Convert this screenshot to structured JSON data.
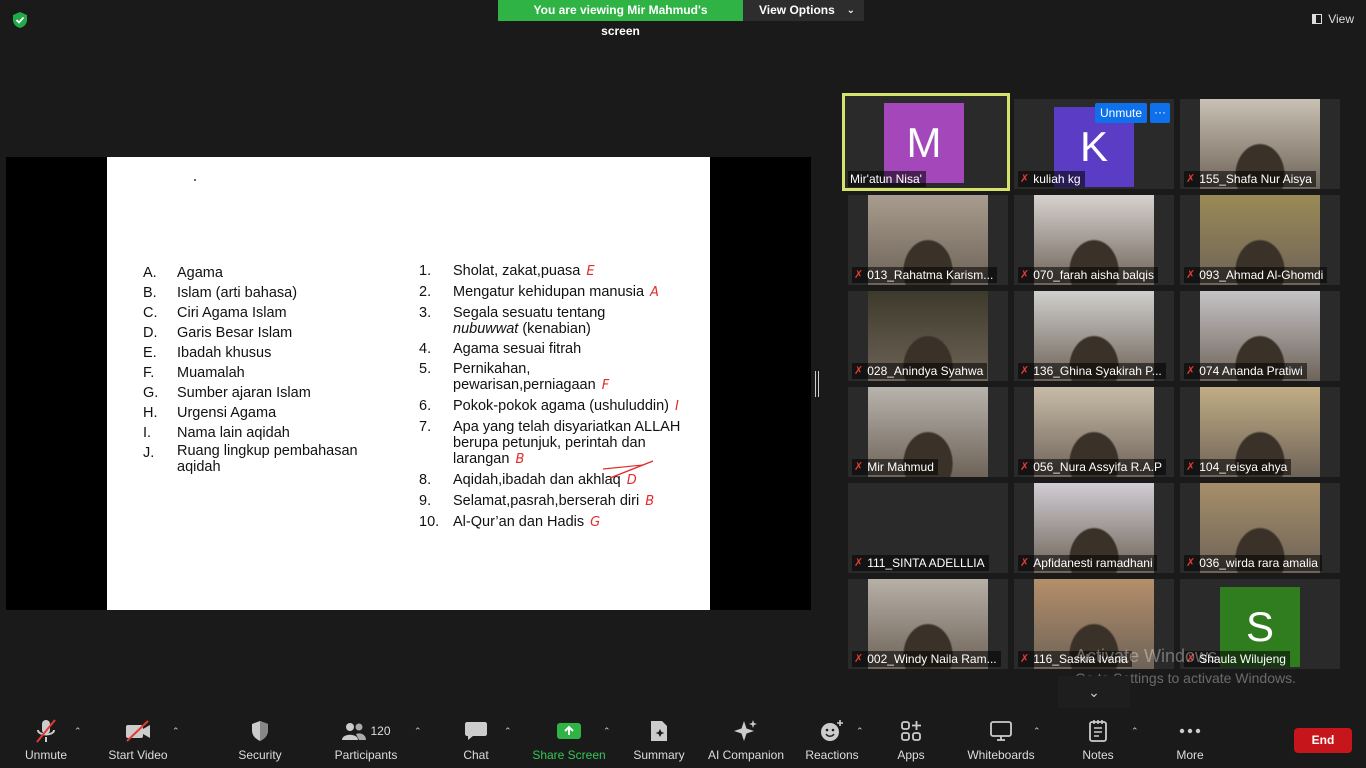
{
  "banner": {
    "viewing": "You are viewing Mir Mahmud's screen",
    "view_options": "View Options"
  },
  "top_right": {
    "view_label": "View"
  },
  "slide": {
    "left_items": [
      {
        "key": "A.",
        "text": "Agama"
      },
      {
        "key": "B.",
        "text": "Islam (arti bahasa)"
      },
      {
        "key": "C.",
        "text": "Ciri Agama Islam"
      },
      {
        "key": "D.",
        "text": "Garis Besar Islam"
      },
      {
        "key": "E.",
        "text": "Ibadah khusus"
      },
      {
        "key": "F.",
        "text": "Muamalah"
      },
      {
        "key": "G.",
        "text": "Sumber ajaran Islam"
      },
      {
        "key": "H.",
        "text": "Urgensi Agama"
      },
      {
        "key": "I.",
        "text": "Nama lain aqidah"
      },
      {
        "key": "J.",
        "text": "Ruang lingkup pembahasan aqidah"
      }
    ],
    "right_items": [
      {
        "key": "1.",
        "text": "Sholat, zakat,puasa",
        "mark": "E"
      },
      {
        "key": "2.",
        "text": "Mengatur kehidupan manusia",
        "mark": "A"
      },
      {
        "key": "3.",
        "text_a": "Segala sesuatu tentang",
        "text_italic": "nubuwwat",
        "text_b": "(kenabian)"
      },
      {
        "key": "4.",
        "text": "Agama sesuai fitrah"
      },
      {
        "key": "5.",
        "text": "Pernikahan, pewarisan,perniagaan",
        "mark": "F"
      },
      {
        "key": "6.",
        "text": "Pokok-pokok agama (ushuluddin)",
        "mark": "I"
      },
      {
        "key": "7.",
        "text": "Apa yang telah disyariatkan ALLAH berupa petunjuk, perintah dan larangan",
        "mark": "B"
      },
      {
        "key": "8.",
        "text": "Aqidah,ibadah dan akhlaq",
        "mark": "D"
      },
      {
        "key": "9.",
        "text": "Selamat,pasrah,berserah diri",
        "mark": "B"
      },
      {
        "key": "10.",
        "text": "Al-Qur’an dan Hadis",
        "mark": "G"
      }
    ]
  },
  "participants": [
    {
      "name": "Mir'atun Nisa'",
      "avatar": "M",
      "color": "#a347ba",
      "active": true,
      "muted": false
    },
    {
      "name": "kuliah kg",
      "avatar": "K",
      "color": "#5b3cc4",
      "muted": true
    },
    {
      "name": "155_Shafa Nur Aisya",
      "muted": true,
      "video": "#c9c1b3"
    },
    {
      "name": "013_Rahatma Karism...",
      "muted": true,
      "video": "#a89c8e"
    },
    {
      "name": "070_farah aisha balqis",
      "muted": true,
      "video": "#d7d2cf"
    },
    {
      "name": "093_Ahmad Al-Ghomdi",
      "muted": true,
      "video": "#9a8a55"
    },
    {
      "name": "028_Anindya Syahwa",
      "muted": true,
      "video": "#3d3a2b"
    },
    {
      "name": "136_Ghina Syakirah P...",
      "muted": true,
      "video": "#cfcfcd"
    },
    {
      "name": "074 Ananda Pratiwi",
      "muted": true,
      "video": "#c5c3c6"
    },
    {
      "name": "Mir Mahmud",
      "muted": true,
      "video": "#b8b3ad"
    },
    {
      "name": "056_Nura Assyifa R.A.P",
      "muted": true,
      "video": "#c8bca8"
    },
    {
      "name": "104_reisya ahya",
      "muted": true,
      "video": "#c1ad84"
    },
    {
      "name": "111_SINTA ADELLLIA",
      "muted": true
    },
    {
      "name": "Apfidanesti ramadhani",
      "muted": true,
      "video": "#d0cdd4"
    },
    {
      "name": "036_wirda rara amalia",
      "muted": true,
      "video": "#a68f69"
    },
    {
      "name": "002_Windy Naila Ram...",
      "muted": true,
      "video": "#b7b0a7"
    },
    {
      "name": "116_Saskia Ivana",
      "muted": true,
      "video": "#b48f6a"
    },
    {
      "name": "Shaula Wilujeng",
      "avatar": "S",
      "color": "#2f7d1f",
      "muted": true
    }
  ],
  "tile_chip": {
    "unmute": "Unmute",
    "more": "···"
  },
  "watermark": {
    "line1": "Activate Windows",
    "line2": "Go to Settings to activate Windows."
  },
  "toolbar": {
    "unmute": "Unmute",
    "start_video": "Start Video",
    "security": "Security",
    "participants": "Participants",
    "participant_count": "120",
    "chat": "Chat",
    "share_screen": "Share Screen",
    "summary": "Summary",
    "ai_companion": "AI Companion",
    "reactions": "Reactions",
    "apps": "Apps",
    "whiteboards": "Whiteboards",
    "notes": "Notes",
    "more": "More",
    "end": "End"
  }
}
